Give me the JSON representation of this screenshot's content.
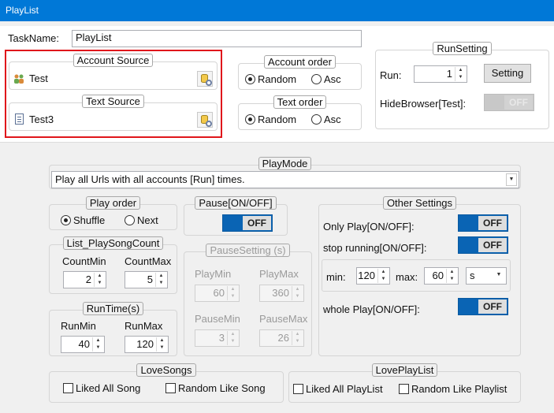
{
  "window": {
    "title": "PlayList"
  },
  "taskname": {
    "label": "TaskName:",
    "value": "PlayList"
  },
  "account_source": {
    "title": "Account Source",
    "item": "Test"
  },
  "text_source": {
    "title": "Text Source",
    "item": "Test3"
  },
  "account_order": {
    "title": "Account order",
    "options": [
      "Random",
      "Asc"
    ],
    "selected": "Random"
  },
  "text_order": {
    "title": "Text order",
    "options": [
      "Random",
      "Asc"
    ],
    "selected": "Random"
  },
  "run_setting": {
    "title": "RunSetting",
    "run_label": "Run:",
    "run_value": "1",
    "setting_button": "Setting",
    "hide_browser_label": "HideBrowser[Test]:",
    "hide_browser_state": "OFF"
  },
  "play_mode": {
    "title": "PlayMode",
    "selected": "Play all Urls with all accounts [Run] times."
  },
  "play_order": {
    "title": "Play order",
    "options": [
      "Shuffle",
      "Next"
    ],
    "selected": "Shuffle"
  },
  "song_count": {
    "title": "List_PlaySongCount",
    "min_label": "CountMin",
    "min_value": "2",
    "max_label": "CountMax",
    "max_value": "5"
  },
  "run_time": {
    "title": "RunTime(s)",
    "min_label": "RunMin",
    "min_value": "40",
    "max_label": "RunMax",
    "max_value": "120"
  },
  "pause": {
    "title": "Pause[ON/OFF]",
    "state": "OFF"
  },
  "pause_setting": {
    "title": "PauseSetting (s)",
    "play_min_label": "PlayMin",
    "play_min_value": "60",
    "play_max_label": "PlayMax",
    "play_max_value": "360",
    "pause_min_label": "PauseMin",
    "pause_min_value": "3",
    "pause_max_label": "PauseMax",
    "pause_max_value": "26"
  },
  "other_settings": {
    "title": "Other Settings",
    "only_play_label": "Only Play[ON/OFF]:",
    "only_play_state": "OFF",
    "stop_running_label": "stop running[ON/OFF]:",
    "stop_running_state": "OFF",
    "min_label": "min:",
    "min_value": "120",
    "max_label": "max:",
    "max_value": "60",
    "unit_value": "s",
    "whole_play_label": "whole Play[ON/OFF]:",
    "whole_play_state": "OFF"
  },
  "love_songs": {
    "title": "LoveSongs",
    "liked_all": "Liked All Song",
    "random_like": "Random Like Song"
  },
  "love_playlist": {
    "title": "LovePlayList",
    "liked_all": "Liked All PlayList",
    "random_like": "Random Like Playlist"
  },
  "colors": {
    "accent": "#0078d7",
    "toggle_blue": "#0a64b4",
    "highlight_red": "#e0161b"
  },
  "icons": {
    "spin_up": "▲",
    "spin_down": "▼",
    "dropdown": "▼"
  }
}
